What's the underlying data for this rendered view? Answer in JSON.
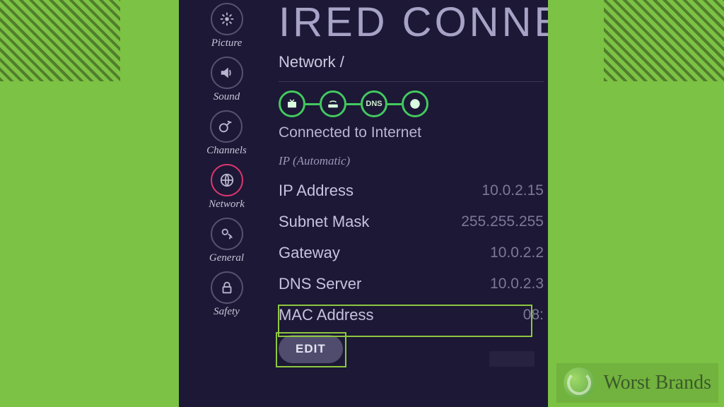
{
  "sidebar": {
    "items": [
      {
        "label": "Picture"
      },
      {
        "label": "Sound"
      },
      {
        "label": "Channels"
      },
      {
        "label": "Network"
      },
      {
        "label": "General"
      },
      {
        "label": "Safety"
      }
    ]
  },
  "header": {
    "title": "IRED CONNEC",
    "breadcrumb": "Network /"
  },
  "connection": {
    "status": "Connected to Internet",
    "dns_node_label": "DNS"
  },
  "ip": {
    "section_label": "IP (Automatic)",
    "rows": {
      "ip_address": {
        "label": "IP Address",
        "value": "10.0.2.15"
      },
      "subnet_mask": {
        "label": "Subnet Mask",
        "value": "255.255.255"
      },
      "gateway": {
        "label": "Gateway",
        "value": "10.0.2.2"
      },
      "dns_server": {
        "label": "DNS Server",
        "value": "10.0.2.3"
      },
      "mac_address": {
        "label": "MAC Address",
        "value": "08:"
      }
    },
    "edit_label": "EDIT"
  },
  "brand": {
    "text": "Worst Brands"
  }
}
